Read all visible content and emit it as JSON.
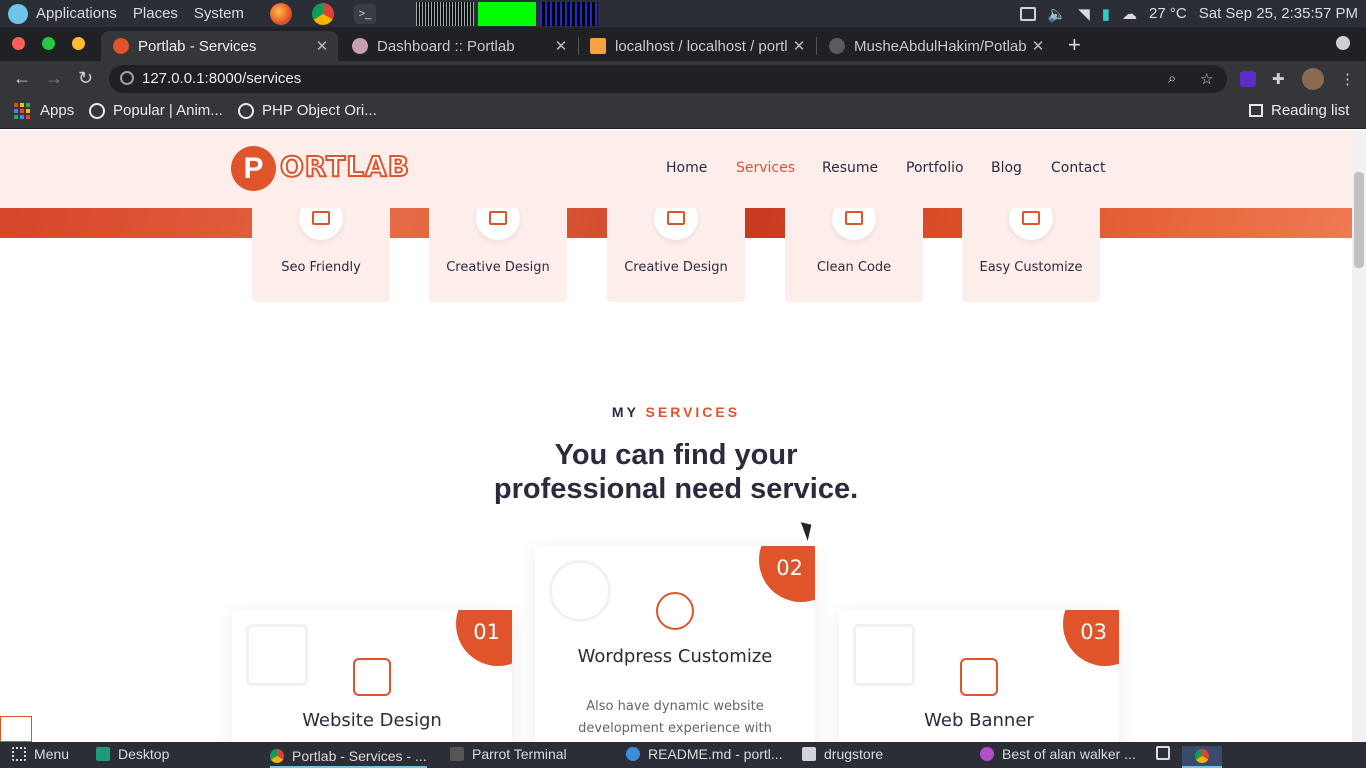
{
  "os_top": {
    "applications": "Applications",
    "places": "Places",
    "system": "System",
    "temperature": "27 °C",
    "datetime": "Sat Sep 25,  2:35:57 PM"
  },
  "tabs": [
    {
      "title": "Portlab - Services",
      "active": true
    },
    {
      "title": "Dashboard :: Portlab",
      "active": false
    },
    {
      "title": "localhost / localhost / portl",
      "active": false
    },
    {
      "title": "MusheAbdulHakim/Potlab",
      "active": false
    }
  ],
  "toolbar": {
    "url": "127.0.0.1:8000/services"
  },
  "bookmarks": {
    "apps": "Apps",
    "items": [
      "Popular | Anim...",
      "PHP Object Ori..."
    ],
    "reading_list": "Reading list"
  },
  "site": {
    "logo_letter": "P",
    "logo_text": "ORTLAB",
    "nav": [
      "Home",
      "Services",
      "Resume",
      "Portfolio",
      "Blog",
      "Contact"
    ],
    "active_nav": "Services",
    "features": [
      "Seo Friendly",
      "Creative Design",
      "Creative Design",
      "Clean Code",
      "Easy Customize"
    ],
    "section_kicker": "MY",
    "section_kicker_accent": "SERVICES",
    "section_title_line1": "You can find your",
    "section_title_line2": "professional need service.",
    "services": [
      {
        "number": "01",
        "title": "Website Design",
        "icon": "monitor-gear-icon"
      },
      {
        "number": "02",
        "title": "Wordpress Customize",
        "icon": "wordpress-icon",
        "desc": "Also have dynamic website development experience with"
      },
      {
        "number": "03",
        "title": "Web Banner",
        "icon": "ad-monitor-icon"
      }
    ]
  },
  "taskbar": {
    "menu": "Menu",
    "items": [
      "Desktop",
      "Portlab - Services - ...",
      "Parrot Terminal",
      "README.md - portl...",
      "drugstore",
      "Best of alan walker ..."
    ]
  },
  "colors": {
    "accent": "#e0542b",
    "header_bg": "#fdeeec",
    "text_dark": "#2d2a3e"
  }
}
